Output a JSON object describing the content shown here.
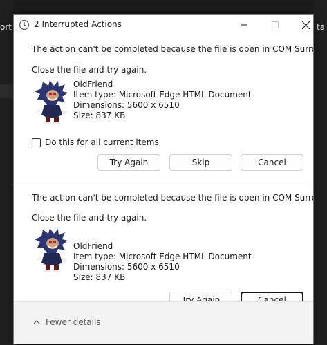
{
  "background": {
    "left_text": "ort",
    "right_text": "ta"
  },
  "titlebar": {
    "title": "2 Interrupted Actions",
    "icon": "clock-icon"
  },
  "item1": {
    "message": "The action can't be completed because the file is open in COM Surrogate",
    "instruction": "Close the file and try again.",
    "file_name": "OldFriend",
    "item_type": "Item type: Microsoft Edge HTML Document",
    "dimensions": "Dimensions: 5600 x 6510",
    "size": "Size: 837 KB",
    "checkbox_label": "Do this for all current items",
    "buttons": {
      "try_again": "Try Again",
      "skip": "Skip",
      "cancel": "Cancel"
    }
  },
  "item2": {
    "message": "The action can't be completed because the file is open in COM Surrogate",
    "instruction": "Close the file and try again.",
    "file_name": "OldFriend",
    "item_type": "Item type: Microsoft Edge HTML Document",
    "dimensions": "Dimensions: 5600 x 6510",
    "size": "Size: 837 KB",
    "buttons": {
      "try_again": "Try Again",
      "cancel": "Cancel"
    }
  },
  "footer": {
    "fewer_details": "Fewer details"
  }
}
